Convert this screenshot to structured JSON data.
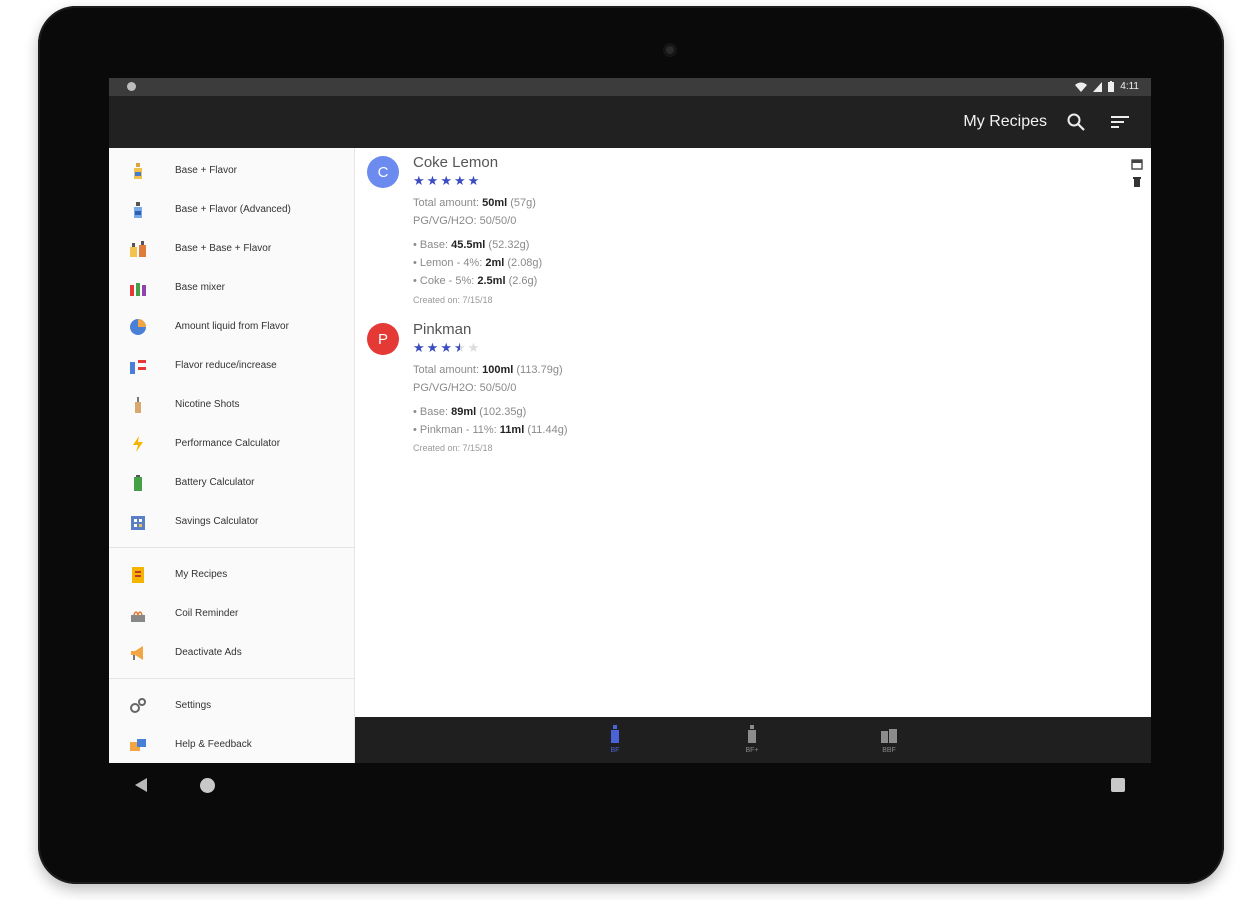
{
  "statusbar": {
    "time": "4:11"
  },
  "appbar": {
    "title": "My Recipes"
  },
  "drawer": {
    "sections": [
      [
        {
          "label": "Base + Flavor",
          "icon": "bottle-flavor-icon"
        },
        {
          "label": "Base + Flavor (Advanced)",
          "icon": "bottle-advanced-icon"
        },
        {
          "label": "Base + Base + Flavor",
          "icon": "bottles-double-icon"
        },
        {
          "label": "Base mixer",
          "icon": "bottles-mixer-icon"
        },
        {
          "label": "Amount liquid from Flavor",
          "icon": "pie-chart-icon"
        },
        {
          "label": "Flavor reduce/increase",
          "icon": "reduce-increase-icon"
        },
        {
          "label": "Nicotine Shots",
          "icon": "nicotine-bottle-icon"
        },
        {
          "label": "Performance Calculator",
          "icon": "lightning-icon"
        },
        {
          "label": "Battery Calculator",
          "icon": "battery-icon"
        },
        {
          "label": "Savings Calculator",
          "icon": "savings-icon"
        }
      ],
      [
        {
          "label": "My Recipes",
          "icon": "recipe-book-icon"
        },
        {
          "label": "Coil Reminder",
          "icon": "coil-icon"
        },
        {
          "label": "Deactivate Ads",
          "icon": "megaphone-icon"
        }
      ],
      [
        {
          "label": "Settings",
          "icon": "gears-icon"
        },
        {
          "label": "Help & Feedback",
          "icon": "help-feedback-icon"
        }
      ]
    ]
  },
  "recipes": [
    {
      "initial": "C",
      "name": "Coke Lemon",
      "avatar_color": "#6b8bef",
      "rating": 5,
      "total_label": "Total amount: ",
      "total_value": "50ml",
      "total_weight": " (57g)",
      "ratio": "PG/VG/H2O: 50/50/0",
      "ingredients": [
        {
          "label": "• Base: ",
          "value": "45.5ml",
          "weight": " (52.32g)"
        },
        {
          "label": "• Lemon - 4%: ",
          "value": "2ml",
          "weight": " (2.08g)"
        },
        {
          "label": "• Coke - 5%: ",
          "value": "2.5ml",
          "weight": " (2.6g)"
        }
      ],
      "created": "Created on: 7/15/18"
    },
    {
      "initial": "P",
      "name": "Pinkman",
      "avatar_color": "#e53935",
      "rating": 3.5,
      "total_label": "Total amount: ",
      "total_value": "100ml",
      "total_weight": " (113.79g)",
      "ratio": "PG/VG/H2O: 50/50/0",
      "ingredients": [
        {
          "label": "• Base: ",
          "value": "89ml",
          "weight": " (102.35g)"
        },
        {
          "label": "• Pinkman - 11%: ",
          "value": "11ml",
          "weight": " (11.44g)"
        }
      ],
      "created": "Created on: 7/15/18"
    }
  ],
  "bottomnav": [
    {
      "label": "BF",
      "icon": "bottle-single-icon",
      "active": true
    },
    {
      "label": "BF+",
      "icon": "bottle-plus-icon",
      "active": false
    },
    {
      "label": "BBF",
      "icon": "bottle-double-icon",
      "active": false
    }
  ],
  "colors": {
    "accent": "#3a4cc0",
    "appbar": "#212121"
  }
}
